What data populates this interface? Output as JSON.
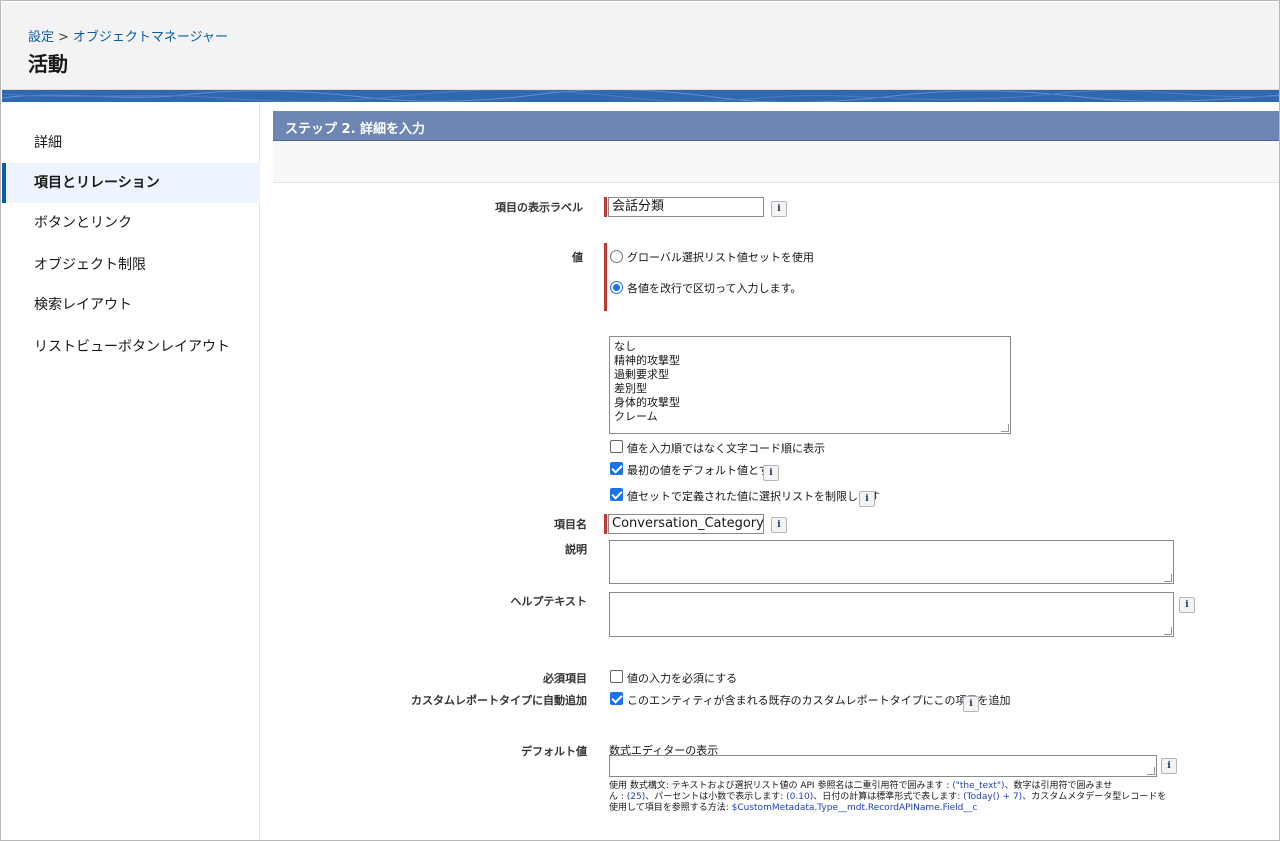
{
  "header": {
    "breadcrumb": {
      "setup": "設定",
      "separator": ">",
      "object_manager": "オブジェクトマネージャー"
    },
    "title": "活動"
  },
  "sidebar": {
    "items": [
      {
        "label": "詳細"
      },
      {
        "label": "項目とリレーション",
        "active": true
      },
      {
        "label": "ボタンとリンク"
      },
      {
        "label": "オブジェクト制限"
      },
      {
        "label": "検索レイアウト"
      },
      {
        "label": "リストビューボタンレイアウト"
      }
    ]
  },
  "form": {
    "section_title": "ステップ 2. 詳細を入力",
    "field_label": {
      "label": "項目の表示ラベル",
      "value": "会話分類"
    },
    "values": {
      "label": "値",
      "option_global": "グローバル選択リスト値セットを使用",
      "option_manual": "各値を改行で区切って入力します。",
      "selected": "manual",
      "entries": [
        "なし",
        "精神的攻撃型",
        "過剰要求型",
        "差別型",
        "身体的攻撃型",
        "クレーム"
      ]
    },
    "checkbox_alpha": {
      "label": "値を入力順ではなく文字コード順に表示",
      "checked": false
    },
    "checkbox_default": {
      "label": "最初の値をデフォルト値とする",
      "checked": true
    },
    "checkbox_restrict": {
      "label": "値セットで定義された値に選択リストを制限します",
      "checked": true
    },
    "api_name": {
      "label": "項目名",
      "value": "Conversation_Category"
    },
    "description": {
      "label": "説明",
      "value": ""
    },
    "help_text": {
      "label": "ヘルプテキスト",
      "value": ""
    },
    "required": {
      "label": "必須項目",
      "checkbox_label": "値の入力を必須にする",
      "checked": false
    },
    "custom_report": {
      "label": "カスタムレポートタイプに自動追加",
      "checkbox_label": "このエンティティが含まれる既存のカスタムレポートタイプにこの項目を追加",
      "checked": true
    },
    "default_value": {
      "label": "デフォルト値",
      "formula_editor_link": "数式エディターの表示",
      "value": "",
      "hint_line1_a": "使用 数式構文: テキストおよび選択リスト値の API 参照名は二重引用符で囲みます : ",
      "hint_line1_code": "(\"the_text\")",
      "hint_line1_b": "、数字は引用符で囲みませ",
      "hint_line2_a": "ん : ",
      "hint_line2_code1": "(25)",
      "hint_line2_b": "、パーセントは小数で表示します: ",
      "hint_line2_code2": "(0.10)",
      "hint_line2_c": "、日付の計算は標準形式で表します: ",
      "hint_line2_code3": "(Today() + 7)",
      "hint_line2_d": "、カスタムメタデータ型レコードを",
      "hint_line3_a": "使用して項目を参照する方法: ",
      "hint_line3_code": "$CustomMetadata.Type__mdt.RecordAPIName.Field__c"
    },
    "info_icon_glyph": "i"
  }
}
